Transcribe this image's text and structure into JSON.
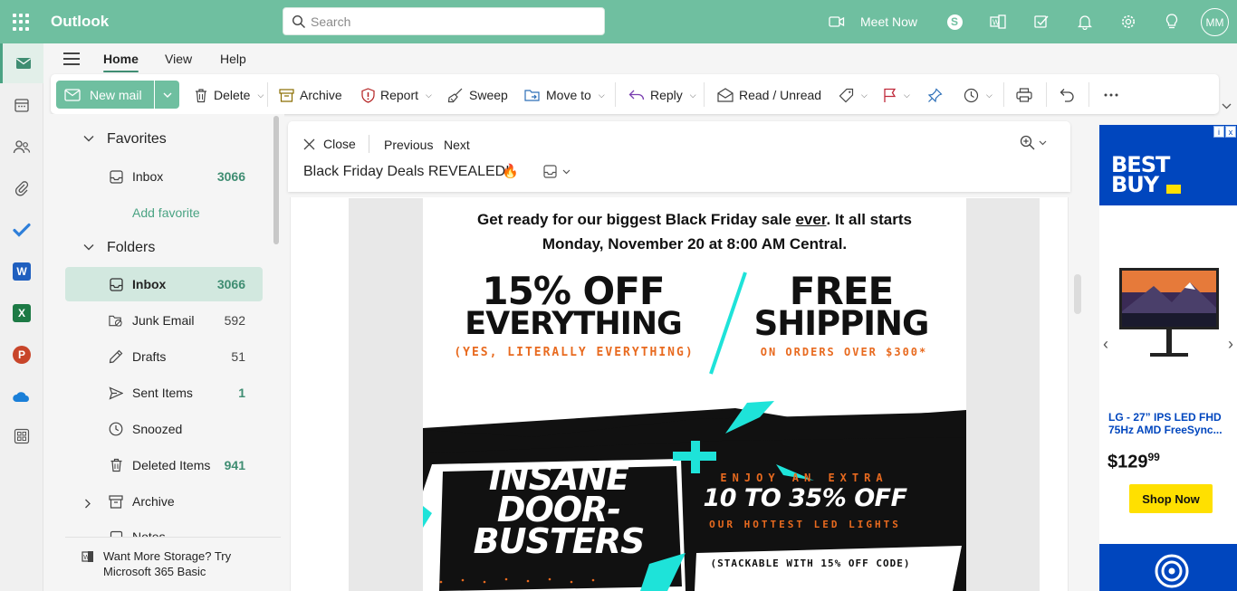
{
  "app": {
    "title": "Outlook",
    "initials": "MM"
  },
  "colors": {
    "brand": "#6fbfa0",
    "accent": "#3f8d72",
    "selected": "#d2e8df",
    "promo_orange": "#e86a1f",
    "promo_cyan": "#1ee3d9",
    "bestbuy_blue": "#0046be",
    "bestbuy_yellow": "#ffe000"
  },
  "search": {
    "placeholder": "Search",
    "value": ""
  },
  "topbar": {
    "meet_now": "Meet Now",
    "icons": [
      "video-icon",
      "skype-icon",
      "teams-icon",
      "todo-icon",
      "bell-icon",
      "gear-icon",
      "lightbulb-icon"
    ]
  },
  "rail": {
    "icons": [
      "mail-icon",
      "calendar-icon",
      "people-icon",
      "attachment-icon",
      "todo-check-icon",
      "word-icon",
      "excel-icon",
      "powerpoint-icon",
      "onedrive-icon",
      "more-apps-icon"
    ]
  },
  "ribbon": {
    "tabs": [
      "Home",
      "View",
      "Help"
    ],
    "new_mail": "New mail",
    "delete": "Delete",
    "archive": "Archive",
    "report": "Report",
    "sweep": "Sweep",
    "move_to": "Move to",
    "reply": "Reply",
    "read_unread": "Read / Unread"
  },
  "folders": {
    "favorites_label": "Favorites",
    "folders_label": "Folders",
    "favorites": [
      {
        "label": "Inbox",
        "count": "3066"
      }
    ],
    "add_favorite": "Add favorite",
    "items": [
      {
        "label": "Inbox",
        "count": "3066"
      },
      {
        "label": "Junk Email",
        "count": "592"
      },
      {
        "label": "Drafts",
        "count": "51"
      },
      {
        "label": "Sent Items",
        "count": "1"
      },
      {
        "label": "Snoozed",
        "count": ""
      },
      {
        "label": "Deleted Items",
        "count": "941"
      },
      {
        "label": "Archive",
        "count": ""
      },
      {
        "label": "Notes",
        "count": ""
      }
    ],
    "storage_promo": "Want More Storage? Try Microsoft 365 Basic"
  },
  "reading": {
    "close": "Close",
    "previous": "Previous",
    "next": "Next",
    "subject": "Black Friday Deals REVEALED!",
    "subject_emoji": "🔥"
  },
  "email": {
    "intro_before": "Get ready for our biggest Black Friday sale ",
    "intro_ever": "ever",
    "intro_after": ". It all starts",
    "intro_line2": "Monday, November 20 at 8:00 AM Central.",
    "offer1_line1": "15% OFF",
    "offer1_line2": "EVERYTHING",
    "offer1_sub": "(YES, LITERALLY EVERYTHING)",
    "offer2_line1": "FREE",
    "offer2_line2": "SHIPPING",
    "offer2_sub": "ON ORDERS OVER $300*",
    "door_line1": "INSANE",
    "door_line2": "DOOR-",
    "door_line3": "BUSTERS",
    "extra_top": "ENJOY AN EXTRA",
    "extra_big": "10 TO 35% OFF",
    "extra_bottom": "OUR HOTTEST LED LIGHTS",
    "stackable": "(STACKABLE WITH 15% OFF CODE)"
  },
  "ad": {
    "logo_line1": "BEST",
    "logo_line2": "BUY",
    "product": "LG - 27” IPS LED FHD 75Hz AMD FreeSync...",
    "price_dollars": "$129",
    "price_cents": "99",
    "cta": "Shop Now",
    "badge_info": "i",
    "badge_close": "x"
  }
}
